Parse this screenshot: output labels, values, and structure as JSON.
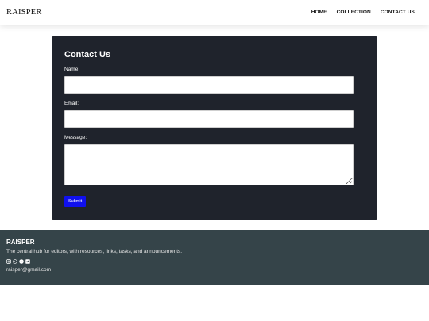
{
  "header": {
    "brand": "RAISPER",
    "nav": [
      {
        "label": "HOME"
      },
      {
        "label": "COLLECTION"
      },
      {
        "label": "CONTACT US"
      }
    ]
  },
  "contact": {
    "title": "Contact Us",
    "name_label": "Name:",
    "email_label": "Email:",
    "message_label": "Message:",
    "name_value": "",
    "email_value": "",
    "message_value": "",
    "submit_label": "Submit"
  },
  "footer": {
    "brand": "RAISPER",
    "tagline": "The central hub for editors, with resources, links, tasks, and announcements.",
    "social_icons": [
      "instagram-icon",
      "whatsapp-icon",
      "discord-icon",
      "twitter-icon"
    ],
    "email": "raisper@gmail.com"
  },
  "colors": {
    "card_bg": "#1f232c",
    "footer_bg": "#354449",
    "submit_bg": "#1010ee"
  }
}
